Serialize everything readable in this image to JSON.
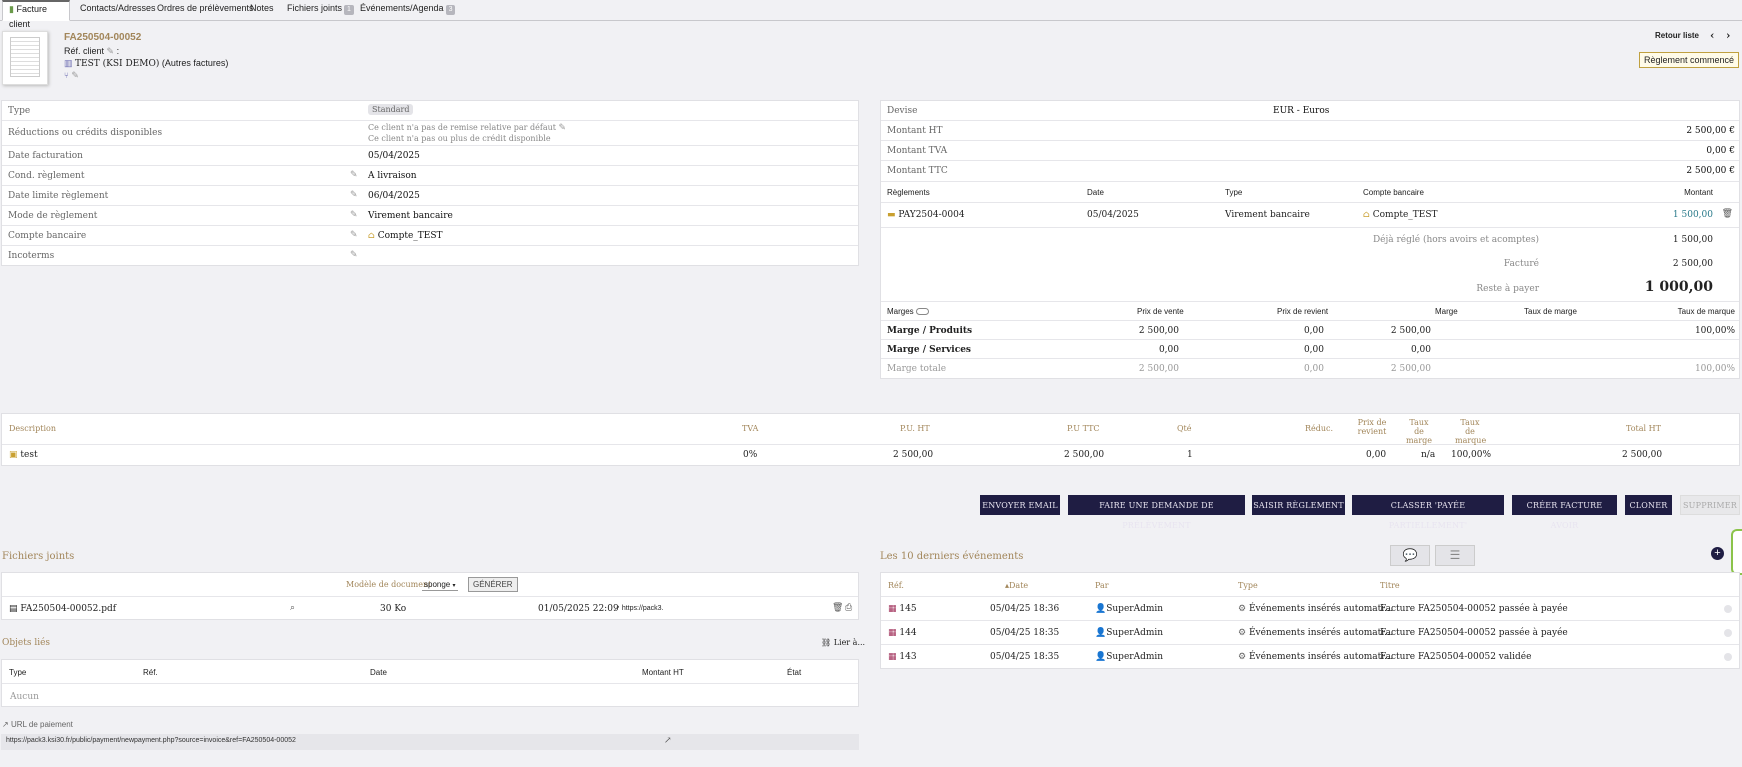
{
  "tabs": [
    {
      "label": "Facture client",
      "active": true
    },
    {
      "label": "Contacts/Adresses"
    },
    {
      "label": "Ordres de prélèvements"
    },
    {
      "label": "Notes"
    },
    {
      "label": "Fichiers joints",
      "badge": "1"
    },
    {
      "label": "Événements/Agenda",
      "badge": "3"
    }
  ],
  "header": {
    "ref": "FA250504-00052",
    "ref_client": "Réf. client",
    "ref_client_sep": ":",
    "thirdparty": "TEST (KSI DEMO)",
    "thirdparty_suffix": "(Autres factures)",
    "back_list": "Retour liste",
    "status": "Règlement commencé"
  },
  "left": {
    "type_label": "Type",
    "type_value": "Standard",
    "reduc_label": "Réductions ou crédits disponibles",
    "reduc_1": "Ce client n'a pas de remise relative par défaut",
    "reduc_2": "Ce client n'a pas ou plus de crédit disponible",
    "date_label": "Date facturation",
    "date_value": "05/04/2025",
    "cond_label": "Cond. règlement",
    "cond_value": "A livraison",
    "limit_label": "Date limite règlement",
    "limit_value": "06/04/2025",
    "mode_label": "Mode de règlement",
    "mode_value": "Virement bancaire",
    "bank_label": "Compte bancaire",
    "bank_value": "Compte_TEST",
    "inco_label": "Incoterms"
  },
  "right": {
    "devise_label": "Devise",
    "devise_value": "EUR - Euros",
    "ht_label": "Montant HT",
    "ht_value": "2 500,00 €",
    "tva_label": "Montant TVA",
    "tva_value": "0,00 €",
    "ttc_label": "Montant TTC",
    "ttc_value": "2 500,00 €",
    "pay_headers": [
      "Règlements",
      "Date",
      "Type",
      "Compte bancaire",
      "Montant"
    ],
    "payment": {
      "ref": "PAY2504-0004",
      "date": "05/04/2025",
      "type": "Virement bancaire",
      "bank": "Compte_TEST",
      "amount": "1 500,00"
    },
    "deja_label": "Déjà réglé (hors avoirs et acomptes)",
    "deja_value": "1 500,00",
    "facture_label": "Facturé",
    "facture_value": "2 500,00",
    "reste_label": "Reste à payer",
    "reste_value": "1 000,00"
  },
  "margins": {
    "headers": [
      "Marges",
      "Prix de vente",
      "Prix de revient",
      "Marge",
      "Taux de marge",
      "Taux de marque"
    ],
    "rows": [
      {
        "label": "Marge / Produits",
        "pv": "2 500,00",
        "pr": "0,00",
        "m": "2 500,00",
        "tm": "",
        "tq": "100,00%"
      },
      {
        "label": "Marge / Services",
        "pv": "0,00",
        "pr": "0,00",
        "m": "0,00",
        "tm": "",
        "tq": ""
      },
      {
        "label": "Marge totale",
        "pv": "2 500,00",
        "pr": "0,00",
        "m": "2 500,00",
        "tm": "",
        "tq": "100,00%"
      }
    ]
  },
  "lines": {
    "headers": {
      "desc": "Description",
      "tva": "TVA",
      "puht": "P.U. HT",
      "puttc": "P.U TTC",
      "qte": "Qté",
      "reduc": "Réduc.",
      "prev1": "Prix de",
      "prev2": "revient",
      "tmarge1": "Taux de",
      "tmarge2": "marge",
      "tmarque1": "Taux de",
      "tmarque2": "marque",
      "total": "Total HT"
    },
    "row": {
      "desc": "test",
      "tva": "0%",
      "puht": "2 500,00",
      "puttc": "2 500,00",
      "qte": "1",
      "reduc": "",
      "prev": "0,00",
      "tmarge": "n/a",
      "tmarque": "100,00%",
      "total": "2 500,00"
    }
  },
  "actions": [
    "ENVOYER EMAIL",
    "FAIRE UNE DEMANDE DE PRÉLÈVEMENT",
    "SAISIR RÈGLEMENT",
    "CLASSER 'PAYÉE PARTIELLEMENT'",
    "CRÉER FACTURE AVOIR",
    "CLONER",
    "SUPPRIMER"
  ],
  "files": {
    "title": "Fichiers joints",
    "model_label": "Modèle de document",
    "model_value": "sponge",
    "generate": "GÉNÉRER",
    "file": {
      "name": "FA250504-00052.pdf",
      "size": "30 Ko",
      "date": "01/05/2025 22:09",
      "link": "https://pack3."
    }
  },
  "linked": {
    "title": "Objets liés",
    "link_label": "Lier à...",
    "headers": [
      "Type",
      "Réf.",
      "Date",
      "Montant HT",
      "État"
    ],
    "empty": "Aucun"
  },
  "payurl": {
    "label": "URL de paiement",
    "value": "https://pack3.ksi30.fr/public/payment/newpayment.php?source=invoice&ref=FA250504-00052"
  },
  "events": {
    "title": "Les 10 derniers événements",
    "headers": [
      "Réf.",
      "Date",
      "Par",
      "Type",
      "Titre"
    ],
    "rows": [
      {
        "ref": "145",
        "date": "05/04/25 18:36",
        "by": "SuperAdmin",
        "type": "Événements insérés automati...",
        "title": "Facture FA250504-00052 passée à payée"
      },
      {
        "ref": "144",
        "date": "05/04/25 18:35",
        "by": "SuperAdmin",
        "type": "Événements insérés automati...",
        "title": "Facture FA250504-00052 passée à payée"
      },
      {
        "ref": "143",
        "date": "05/04/25 18:35",
        "by": "SuperAdmin",
        "type": "Événements insérés automati...",
        "title": "Facture FA250504-00052 validée"
      }
    ]
  },
  "colors": {
    "navy": "#1f1d43",
    "gold": "#a2865a",
    "teal": "#2a7a8a"
  }
}
